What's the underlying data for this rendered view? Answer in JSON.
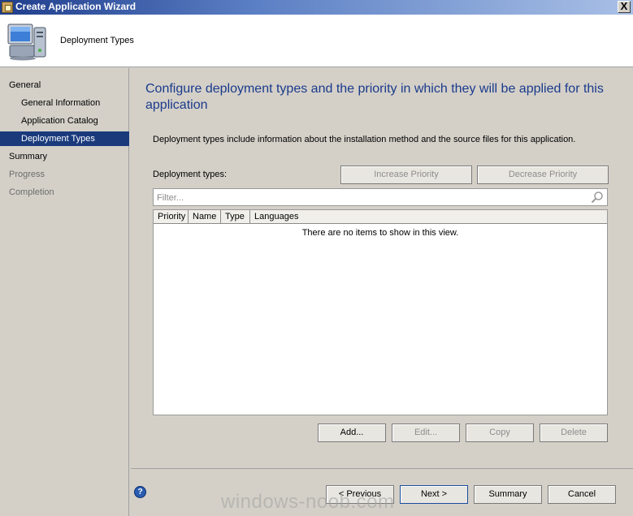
{
  "window": {
    "title": "Create Application Wizard",
    "close_glyph": "X"
  },
  "header": {
    "title": "Deployment Types",
    "icon": "computer-icon"
  },
  "nav": {
    "items": [
      {
        "label": "General",
        "level": 0,
        "state": "normal"
      },
      {
        "label": "General Information",
        "level": 1,
        "state": "normal"
      },
      {
        "label": "Application Catalog",
        "level": 1,
        "state": "normal"
      },
      {
        "label": "Deployment Types",
        "level": 1,
        "state": "active"
      },
      {
        "label": "Summary",
        "level": 0,
        "state": "normal"
      },
      {
        "label": "Progress",
        "level": 0,
        "state": "disabled"
      },
      {
        "label": "Completion",
        "level": 0,
        "state": "disabled"
      }
    ]
  },
  "content": {
    "heading": "Configure deployment types and the priority in which they will be applied for this application",
    "description": "Deployment types include information about the installation method and the source files for this application.",
    "deployment_types_label": "Deployment types:",
    "increase_priority": "Increase Priority",
    "decrease_priority": "Decrease Priority",
    "filter_placeholder": "Filter...",
    "columns": [
      "Priority",
      "Name",
      "Type",
      "Languages"
    ],
    "empty_text": "There are no items to show in this view.",
    "add": "Add...",
    "edit": "Edit...",
    "copy": "Copy",
    "delete": "Delete"
  },
  "footer": {
    "previous": "< Previous",
    "next": "Next >",
    "summary": "Summary",
    "cancel": "Cancel",
    "help_glyph": "?"
  },
  "watermark": "windows-noob.com"
}
